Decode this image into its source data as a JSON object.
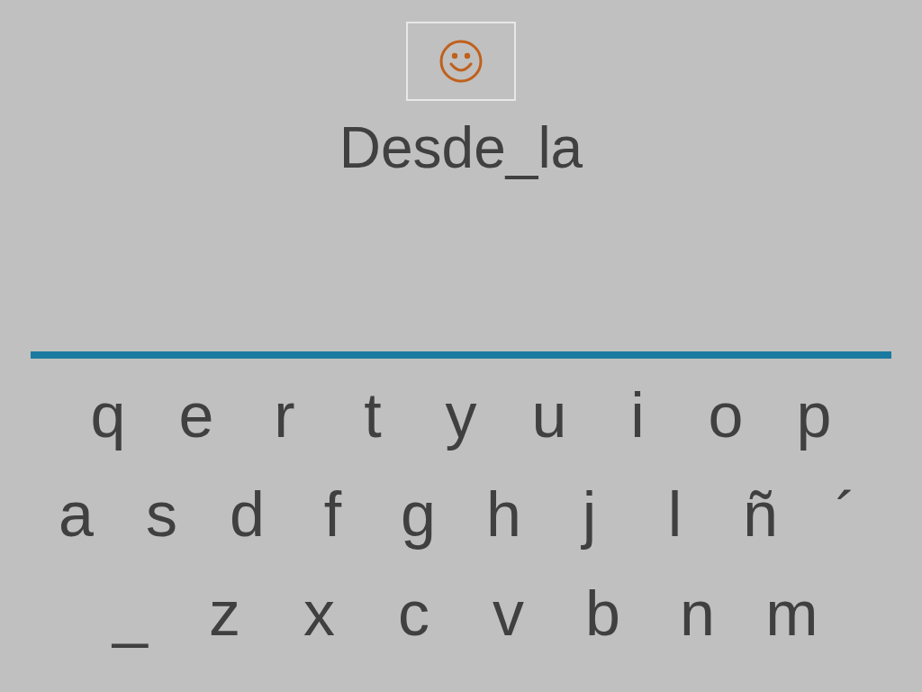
{
  "prompt": {
    "word": "Desde_la"
  },
  "keyboard": {
    "rows": [
      [
        "q",
        "e",
        "r",
        "t",
        "y",
        "u",
        "i",
        "o",
        "p"
      ],
      [
        "a",
        "s",
        "d",
        "f",
        "g",
        "h",
        "j",
        "l",
        "ñ",
        "´"
      ],
      [
        "_",
        "z",
        "x",
        "c",
        "v",
        "b",
        "n",
        "m"
      ]
    ]
  }
}
